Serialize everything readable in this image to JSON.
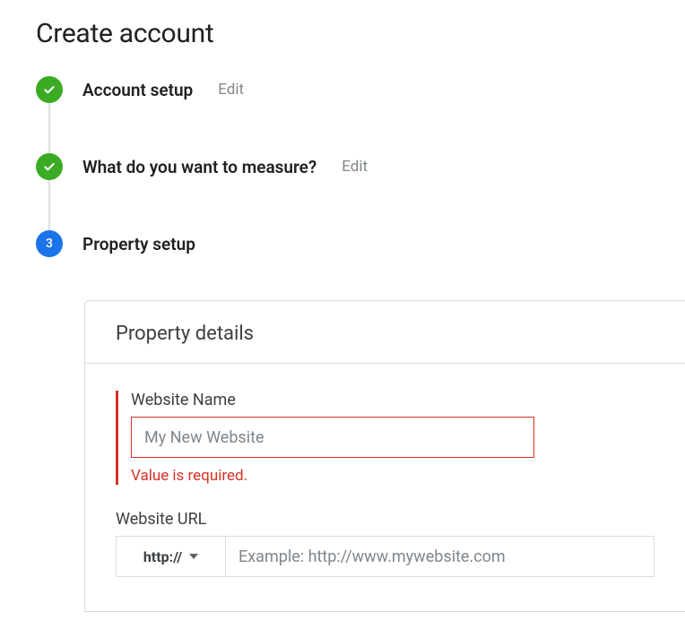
{
  "page": {
    "title": "Create account"
  },
  "steps": [
    {
      "title": "Account setup",
      "edit": "Edit"
    },
    {
      "title": "What do you want to measure?",
      "edit": "Edit"
    },
    {
      "number": "3",
      "title": "Property setup"
    }
  ],
  "card": {
    "header": "Property details"
  },
  "fields": {
    "name": {
      "label": "Website Name",
      "placeholder": "My New Website",
      "error": "Value is required."
    },
    "url": {
      "label": "Website URL",
      "protocol": "http://",
      "placeholder": "Example: http://www.mywebsite.com"
    }
  }
}
